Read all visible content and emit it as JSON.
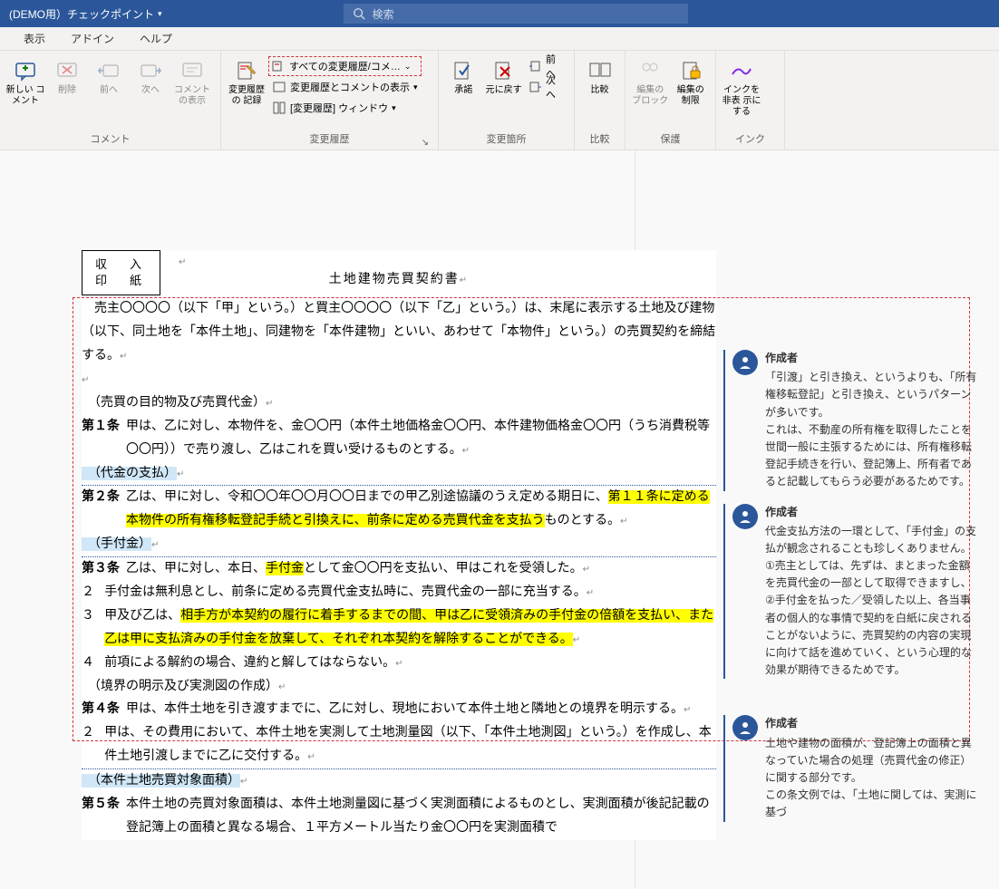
{
  "titlebar": {
    "doc_title": "(DEMO用）チェックポイント",
    "search_placeholder": "検索"
  },
  "tabs": {
    "view": "表示",
    "addin": "アドイン",
    "help": "ヘルプ"
  },
  "ribbon": {
    "comment_group": "コメント",
    "new_comment": "新しい\nコメント",
    "delete": "削除",
    "prev": "前へ",
    "next": "次へ",
    "show_comments": "コメント\nの表示",
    "track_group": "変更履歴",
    "track_btn": "変更履歴の\n記録",
    "display_for_review": "すべての変更履歴/コメ…",
    "show_markup": "変更履歴とコメントの表示",
    "reviewing_pane": "[変更履歴] ウィンドウ",
    "changes_group": "変更箇所",
    "accept": "承諾",
    "reject": "元に戻す",
    "prev2": "前へ",
    "next2": "次へ",
    "compare_group": "比較",
    "compare": "比較",
    "protect_group": "保護",
    "block": "編集の\nブロック",
    "restrict": "編集の\n制限",
    "ink_group": "インク",
    "hide_ink": "インクを非表\n示にする"
  },
  "doc": {
    "stamp1": "収　入",
    "stamp2": "印　紙",
    "title": "土地建物売買契約書",
    "preamble1": "　売主〇〇〇〇（以下「甲」という。）と買主〇〇〇〇（以下「乙」という。）は、末尾に表示する土地及び建物（以下、同土地を「本件土地」、同建物を「本件建物」といい、あわせて「本物件」という。）の売買契約を締結する。",
    "h1": "（売買の目的物及び売買代金）",
    "a1_num": "第１条",
    "a1": "甲は、乙に対し、本物件を、金〇〇円（本件土地価格金〇〇円、本件建物価格金〇〇円（うち消費税等〇〇円））で売り渡し、乙はこれを買い受けるものとする。",
    "h2": "（代金の支払）",
    "a2_num": "第２条",
    "a2_p1": "乙は、甲に対し、令和〇〇年〇〇月〇〇日までの甲乙別途協議のうえ定める期日に、",
    "a2_p2": "第１１条に定める本物件の所有権移転登記手続と引換えに、前条に定める売買代金を支払う",
    "a2_p3": "ものとする。",
    "h3": "（手付金）",
    "a3_num": "第３条",
    "a3_1a": "乙は、甲に対し、本日、",
    "a3_1b": "手付金",
    "a3_1c": "として金〇〇円を支払い、甲はこれを受領した。",
    "a3_2": "手付金は無利息とし、前条に定める売買代金支払時に、売買代金の一部に充当する。",
    "a3_3a": "甲及び乙は、",
    "a3_3b": "相手方が本契約の履行に着手するまでの間、甲は乙に受領済みの手付金の倍額を支払い、また乙は甲に支払済みの手付金を放棄して、それぞれ本契約を解除することができる。",
    "a3_4": "前項による解約の場合、違約と解してはならない。",
    "h4": "（境界の明示及び実測図の作成）",
    "a4_num": "第４条",
    "a4_1": "甲は、本件土地を引き渡すまでに、乙に対し、現地において本件土地と隣地との境界を明示する。",
    "a4_2": "甲は、その費用において、本件土地を実測して土地測量図（以下、「本件土地測図」という。）を作成し、本件土地引渡しまでに乙に交付する。",
    "h5": "（本件土地売買対象面積）",
    "a5_num": "第５条",
    "a5_1": "本件土地の売買対象面積は、本件土地測量図に基づく実測面積によるものとし、実測面積が後記記載の登記簿上の面積と異なる場合、１平方メートル当たり金〇〇円を実測面積で"
  },
  "comments": {
    "author": "作成者",
    "c1": "「引渡」と引き換え、というよりも、「所有権移転登記」と引き換え、というパターンが多いです。\nこれは、不動産の所有権を取得したことを世間一般に主張するためには、所有権移転登記手続きを行い、登記簿上、所有者であると記載してもらう必要があるためです。",
    "c2": "代金支払方法の一環として、「手付金」の支払が観念されることも珍しくありません。\n①売主としては、先ずは、まとまった金額を売買代金の一部として取得できますし、\n②手付金を払った／受領した以上、各当事者の個人的な事情で契約を白紙に戻されることがないように、売買契約の内容の実現に向けて話を進めていく、という心理的な効果が期待できるためです。",
    "c3": "土地や建物の面積が、登記簿上の面積と異なっていた場合の処理（売買代金の修正）に関する部分です。\nこの条文例では、「土地に関しては、実測に基づ"
  }
}
